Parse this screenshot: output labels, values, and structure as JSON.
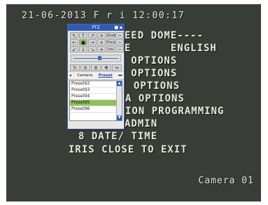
{
  "osd": {
    "timestamp": "21-06-2013 F r i 12:00:17",
    "menu_lines": [
      "SPEED DOME----",
      "AGE      ENGLISH",
      "AY OPTIONS",
      "OL OPTIONS",
      "OPTIONS",
      "A OPTIONS",
      "ION PROGRAMMING",
      "7 USER ADMIN",
      "8 DATE/ TIME",
      "IRIS CLOSE TO EXIT"
    ],
    "camera_label": "Camera 01"
  },
  "ptz": {
    "title": "PTZ",
    "buttons": [
      "↖",
      "↑",
      "↗",
      "+",
      "Zoom",
      "−",
      "←",
      "●",
      "→",
      "+",
      "Focus",
      "−",
      "↙",
      "↓",
      "↘",
      "+",
      "Iris",
      "−"
    ],
    "tools": [
      "↻",
      "⊘",
      "⊕",
      "✥",
      "⇔"
    ],
    "tabs": {
      "left_arrow": "◂",
      "camera": "Camera",
      "preset": "Preset",
      "right_arrow": "▸▸"
    },
    "presets": [
      "Preset92",
      "Preset93",
      "Preset94",
      "Preset95",
      "Preset96"
    ],
    "selected_preset": "Preset95"
  }
}
